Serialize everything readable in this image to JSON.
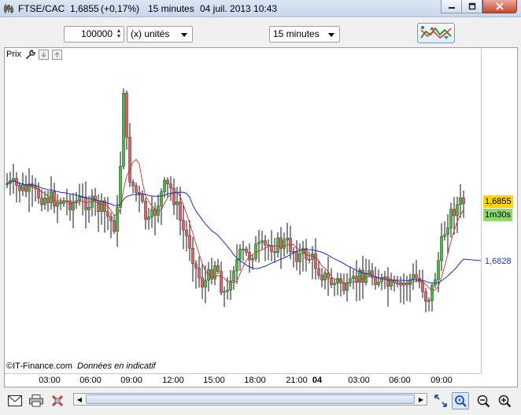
{
  "title": {
    "instrument": "FTSE/CAC",
    "price": "1,6855",
    "change": "(+0,17%)",
    "interval": "15 minutes",
    "datetime": "04 juil. 2013 10:43"
  },
  "toolbar": {
    "quantity": "100000",
    "units": "(x) unités",
    "interval": "15 minutes"
  },
  "chart": {
    "panel_label": "Prix",
    "last_price": "1,6855",
    "countdown": "1m30s",
    "ma_value": "1,6828",
    "credit_source": "©IT-Finance.com",
    "credit_note": "Données en indicatif",
    "x_ticks": [
      "03:00",
      "06:00",
      "09:00",
      "12:00",
      "15:00",
      "18:00",
      "21:00",
      "04",
      "03:00",
      "06:00",
      "09:00"
    ]
  },
  "colors": {
    "up": "#4fb848",
    "down": "#d9646a",
    "ma_fast": "#c0392b",
    "ma_slow": "#1f2fb0",
    "last_price_bg": "#ffd400",
    "countdown_bg": "#8fd86a",
    "ma_label": "#2a3bb8"
  },
  "chart_data": {
    "type": "candlestick",
    "y_axis_labels": [
      "1,6855",
      "1,6828"
    ],
    "x_tick_labels": [
      "03:00",
      "06:00",
      "09:00",
      "12:00",
      "15:00",
      "18:00",
      "21:00",
      "04",
      "03:00",
      "06:00",
      "09:00"
    ],
    "bold_tick": "04",
    "series": [
      {
        "style": "candles"
      },
      {
        "style": "line",
        "color": "#c0392b"
      },
      {
        "style": "line",
        "color": "#1f2fb0"
      }
    ]
  }
}
